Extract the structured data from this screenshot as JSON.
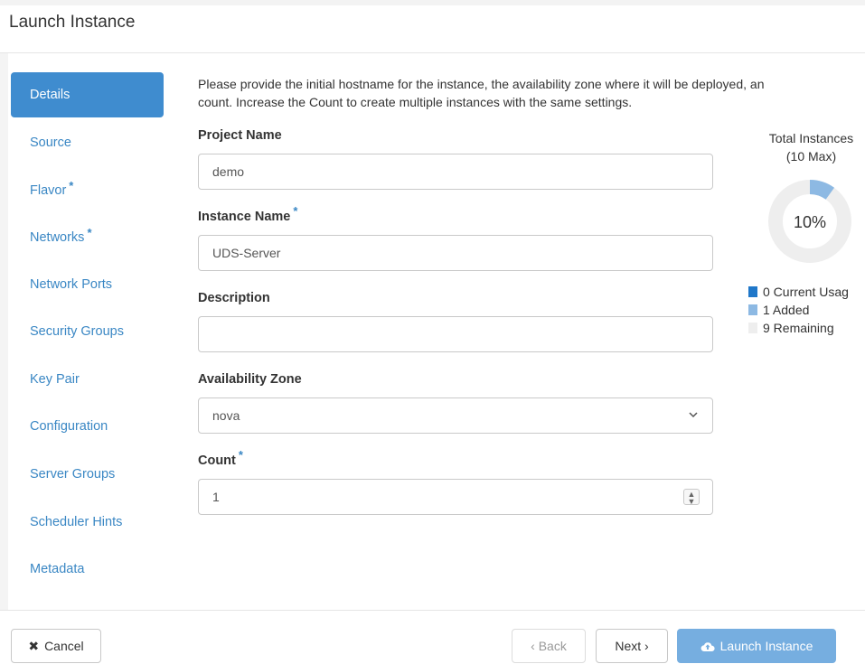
{
  "dialog": {
    "title": "Launch Instance"
  },
  "sidebar": {
    "items": [
      {
        "label": "Details",
        "required": false,
        "active": true
      },
      {
        "label": "Source",
        "required": false
      },
      {
        "label": "Flavor",
        "required": true
      },
      {
        "label": "Networks",
        "required": true
      },
      {
        "label": "Network Ports",
        "required": false
      },
      {
        "label": "Security Groups",
        "required": false
      },
      {
        "label": "Key Pair",
        "required": false
      },
      {
        "label": "Configuration",
        "required": false
      },
      {
        "label": "Server Groups",
        "required": false
      },
      {
        "label": "Scheduler Hints",
        "required": false
      },
      {
        "label": "Metadata",
        "required": false
      }
    ],
    "required_marker": "*"
  },
  "intro": {
    "line1": "Please provide the initial hostname for the instance, the availability zone where it will be deployed, an",
    "line2": "count. Increase the Count to create multiple instances with the same settings."
  },
  "form": {
    "project_name": {
      "label": "Project Name",
      "value": "demo"
    },
    "instance_name": {
      "label": "Instance Name",
      "value": "UDS-Server",
      "required": true
    },
    "description": {
      "label": "Description",
      "value": ""
    },
    "availability_zone": {
      "label": "Availability Zone",
      "value": "nova"
    },
    "count": {
      "label": "Count",
      "value": "1",
      "required": true
    }
  },
  "chart": {
    "title_line1": "Total Instances",
    "title_line2": "(10 Max)",
    "center_label": "10%",
    "max": 10,
    "legend": [
      {
        "label": "0 Current Usag",
        "value": 0,
        "color": "#1f77c9"
      },
      {
        "label": "1 Added",
        "value": 1,
        "color": "#8db9e3"
      },
      {
        "label": "9 Remaining",
        "value": 9,
        "color": "#eeeeee"
      }
    ]
  },
  "footer": {
    "cancel": "Cancel",
    "back": "‹ Back",
    "next": "Next ›",
    "launch": "Launch Instance"
  },
  "colors": {
    "accent": "#3f8ccf",
    "link": "#3a87c4",
    "primary_disabled": "#76aee0"
  }
}
